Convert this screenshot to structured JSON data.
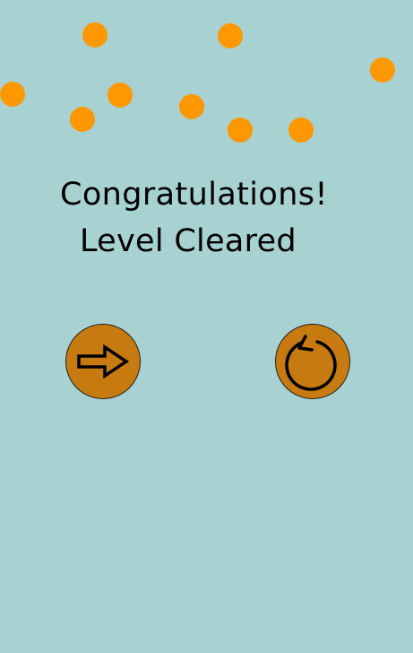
{
  "screen": {
    "background": "#a8d1d1",
    "confetti_color": "#ff9800",
    "button_color": "#c77a10"
  },
  "message": {
    "line1": "Congratulations!",
    "line2": "Level Cleared"
  },
  "buttons": {
    "next": {
      "icon": "arrow-right-icon"
    },
    "retry": {
      "icon": "restart-icon"
    }
  }
}
